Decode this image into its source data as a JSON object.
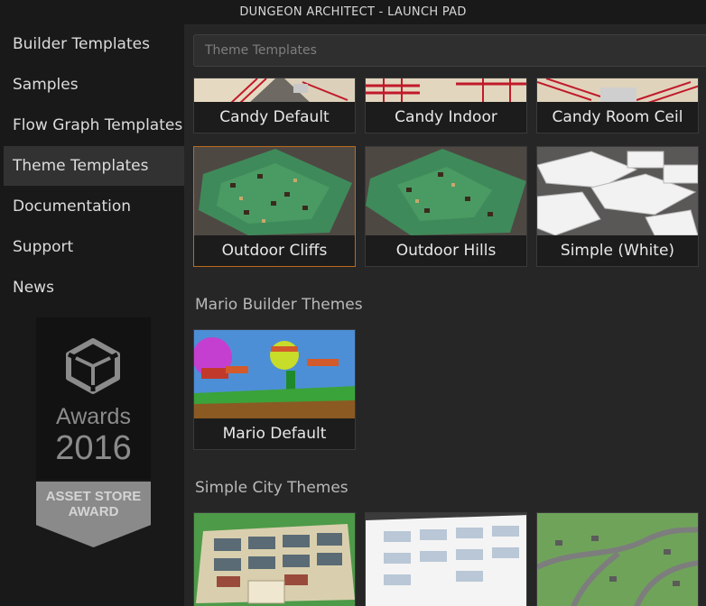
{
  "window": {
    "title": "DUNGEON ARCHITECT - LAUNCH PAD"
  },
  "sidebar": {
    "items": [
      {
        "label": "Builder Templates"
      },
      {
        "label": "Samples"
      },
      {
        "label": "Flow Graph Templates"
      },
      {
        "label": "Theme Templates",
        "active": true
      },
      {
        "label": "Documentation"
      },
      {
        "label": "Support"
      },
      {
        "label": "News"
      }
    ],
    "award": {
      "line1": "Awards",
      "line2": "2016",
      "badge_line1": "ASSET STORE",
      "badge_line2": "AWARD"
    }
  },
  "main": {
    "search_placeholder": "Theme Templates",
    "sections": [
      {
        "title": "",
        "cards": [
          {
            "label": "Candy Default"
          },
          {
            "label": "Candy Indoor"
          },
          {
            "label": "Candy Room Ceil"
          },
          {
            "label": "Outdoor Cliffs",
            "selected": true
          },
          {
            "label": "Outdoor Hills"
          },
          {
            "label": "Simple (White)"
          }
        ]
      },
      {
        "title": "Mario Builder Themes",
        "cards": [
          {
            "label": "Mario Default"
          }
        ]
      },
      {
        "title": "Simple City Themes",
        "cards": [
          {
            "label": ""
          },
          {
            "label": ""
          },
          {
            "label": ""
          }
        ]
      }
    ]
  },
  "colors": {
    "background": "#262626",
    "sidebar": "#191919",
    "active_item": "#323232",
    "selected_border": "#b96a1e",
    "text": "#dcdcdc"
  }
}
